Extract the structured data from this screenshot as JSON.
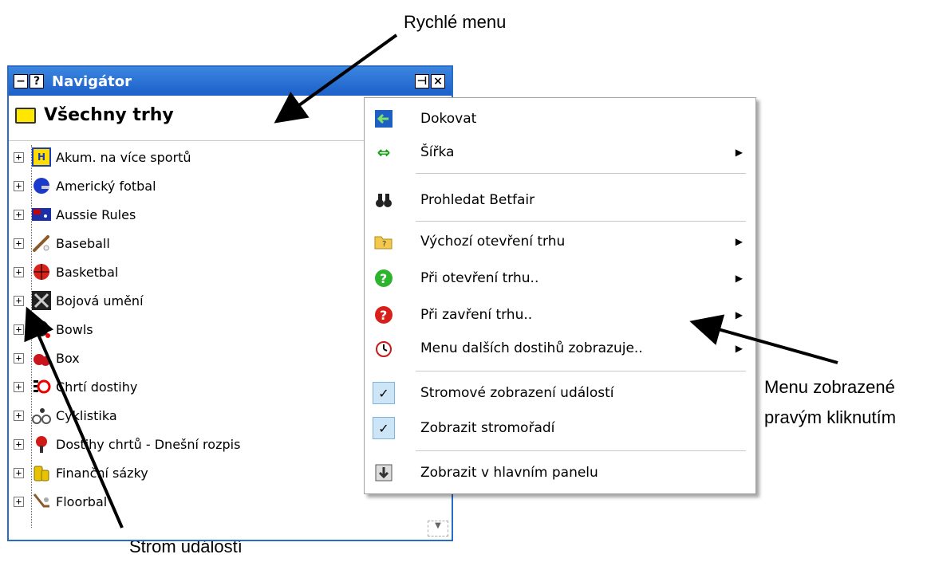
{
  "annotations": {
    "quick_menu": "Rychlé menu",
    "right_click_menu_line1": "Menu zobrazené",
    "right_click_menu_line2": "pravým kliknutím",
    "event_tree": "Strom událostí"
  },
  "navigator": {
    "title": "Navigátor",
    "title_buttons_left": [
      "minimize-icon",
      "help-icon"
    ],
    "title_buttons_right": [
      "pin-icon",
      "close-icon"
    ],
    "root_label": "Všechny trhy",
    "items": [
      {
        "label": "Akum. na více sportů",
        "icon": "multi-sport-icon"
      },
      {
        "label": "Americký fotbal",
        "icon": "football-helmet-icon"
      },
      {
        "label": "Aussie Rules",
        "icon": "australia-flag-icon"
      },
      {
        "label": "Baseball",
        "icon": "baseball-bat-icon"
      },
      {
        "label": "Basketbal",
        "icon": "basketball-icon"
      },
      {
        "label": "Bojová umění",
        "icon": "martial-arts-icon"
      },
      {
        "label": "Bowls",
        "icon": "bowls-icon"
      },
      {
        "label": "Box",
        "icon": "boxing-glove-icon"
      },
      {
        "label": "Chrtí dostihy",
        "icon": "greyhound-icon"
      },
      {
        "label": "Cyklistika",
        "icon": "cyclist-icon"
      },
      {
        "label": "Dostihy chrtů - Dnešní rozpis",
        "icon": "pin-marker-icon"
      },
      {
        "label": "Finanční sázky",
        "icon": "coins-icon"
      },
      {
        "label": "Floorbal",
        "icon": "floorball-stick-icon"
      }
    ]
  },
  "menu": {
    "items": [
      {
        "label": "Dokovat",
        "icon": "dock-icon",
        "submenu": false
      },
      {
        "label": "Šířka",
        "icon": "width-arrows-icon",
        "submenu": true
      },
      {
        "label": "Prohledat Betfair",
        "icon": "binoculars-icon",
        "submenu": false
      },
      {
        "label": "Výchozí otevření trhu",
        "icon": "open-folder-icon",
        "submenu": true
      },
      {
        "label": "Při otevření trhu..",
        "icon": "green-question-icon",
        "submenu": true
      },
      {
        "label": "Při zavření trhu..",
        "icon": "red-question-icon",
        "submenu": true
      },
      {
        "label": "Menu dalších dostihů zobrazuje..",
        "icon": "stopwatch-icon",
        "submenu": true
      },
      {
        "label": "Stromové zobrazení událostí",
        "icon": "check-icon",
        "submenu": false,
        "checked": true
      },
      {
        "label": "Zobrazit stromořadí",
        "icon": "check-icon",
        "submenu": false,
        "checked": true
      },
      {
        "label": "Zobrazit v hlavním panelu",
        "icon": "down-arrow-icon",
        "submenu": false
      }
    ]
  }
}
